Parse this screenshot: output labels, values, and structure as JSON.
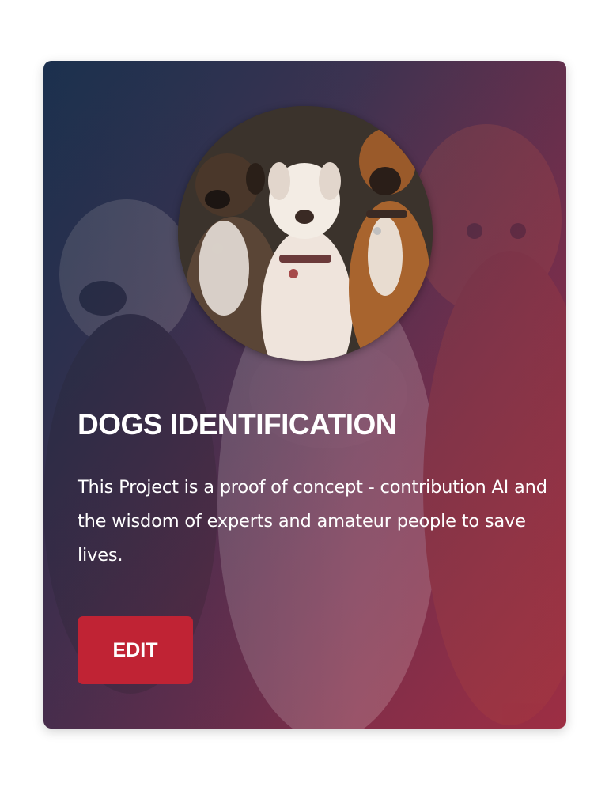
{
  "card": {
    "title": "DOGS IDENTIFICATION",
    "description": "This Project is a proof of concept - contribution AI and the wisdom of experts and amateur people to save lives.",
    "edit_label": "EDIT",
    "image_subject": "three-dogs-photo",
    "colors": {
      "gradient_start": "#1f3552",
      "gradient_end": "#9a2f45",
      "button": "#c02334",
      "text": "#ffffff"
    }
  }
}
